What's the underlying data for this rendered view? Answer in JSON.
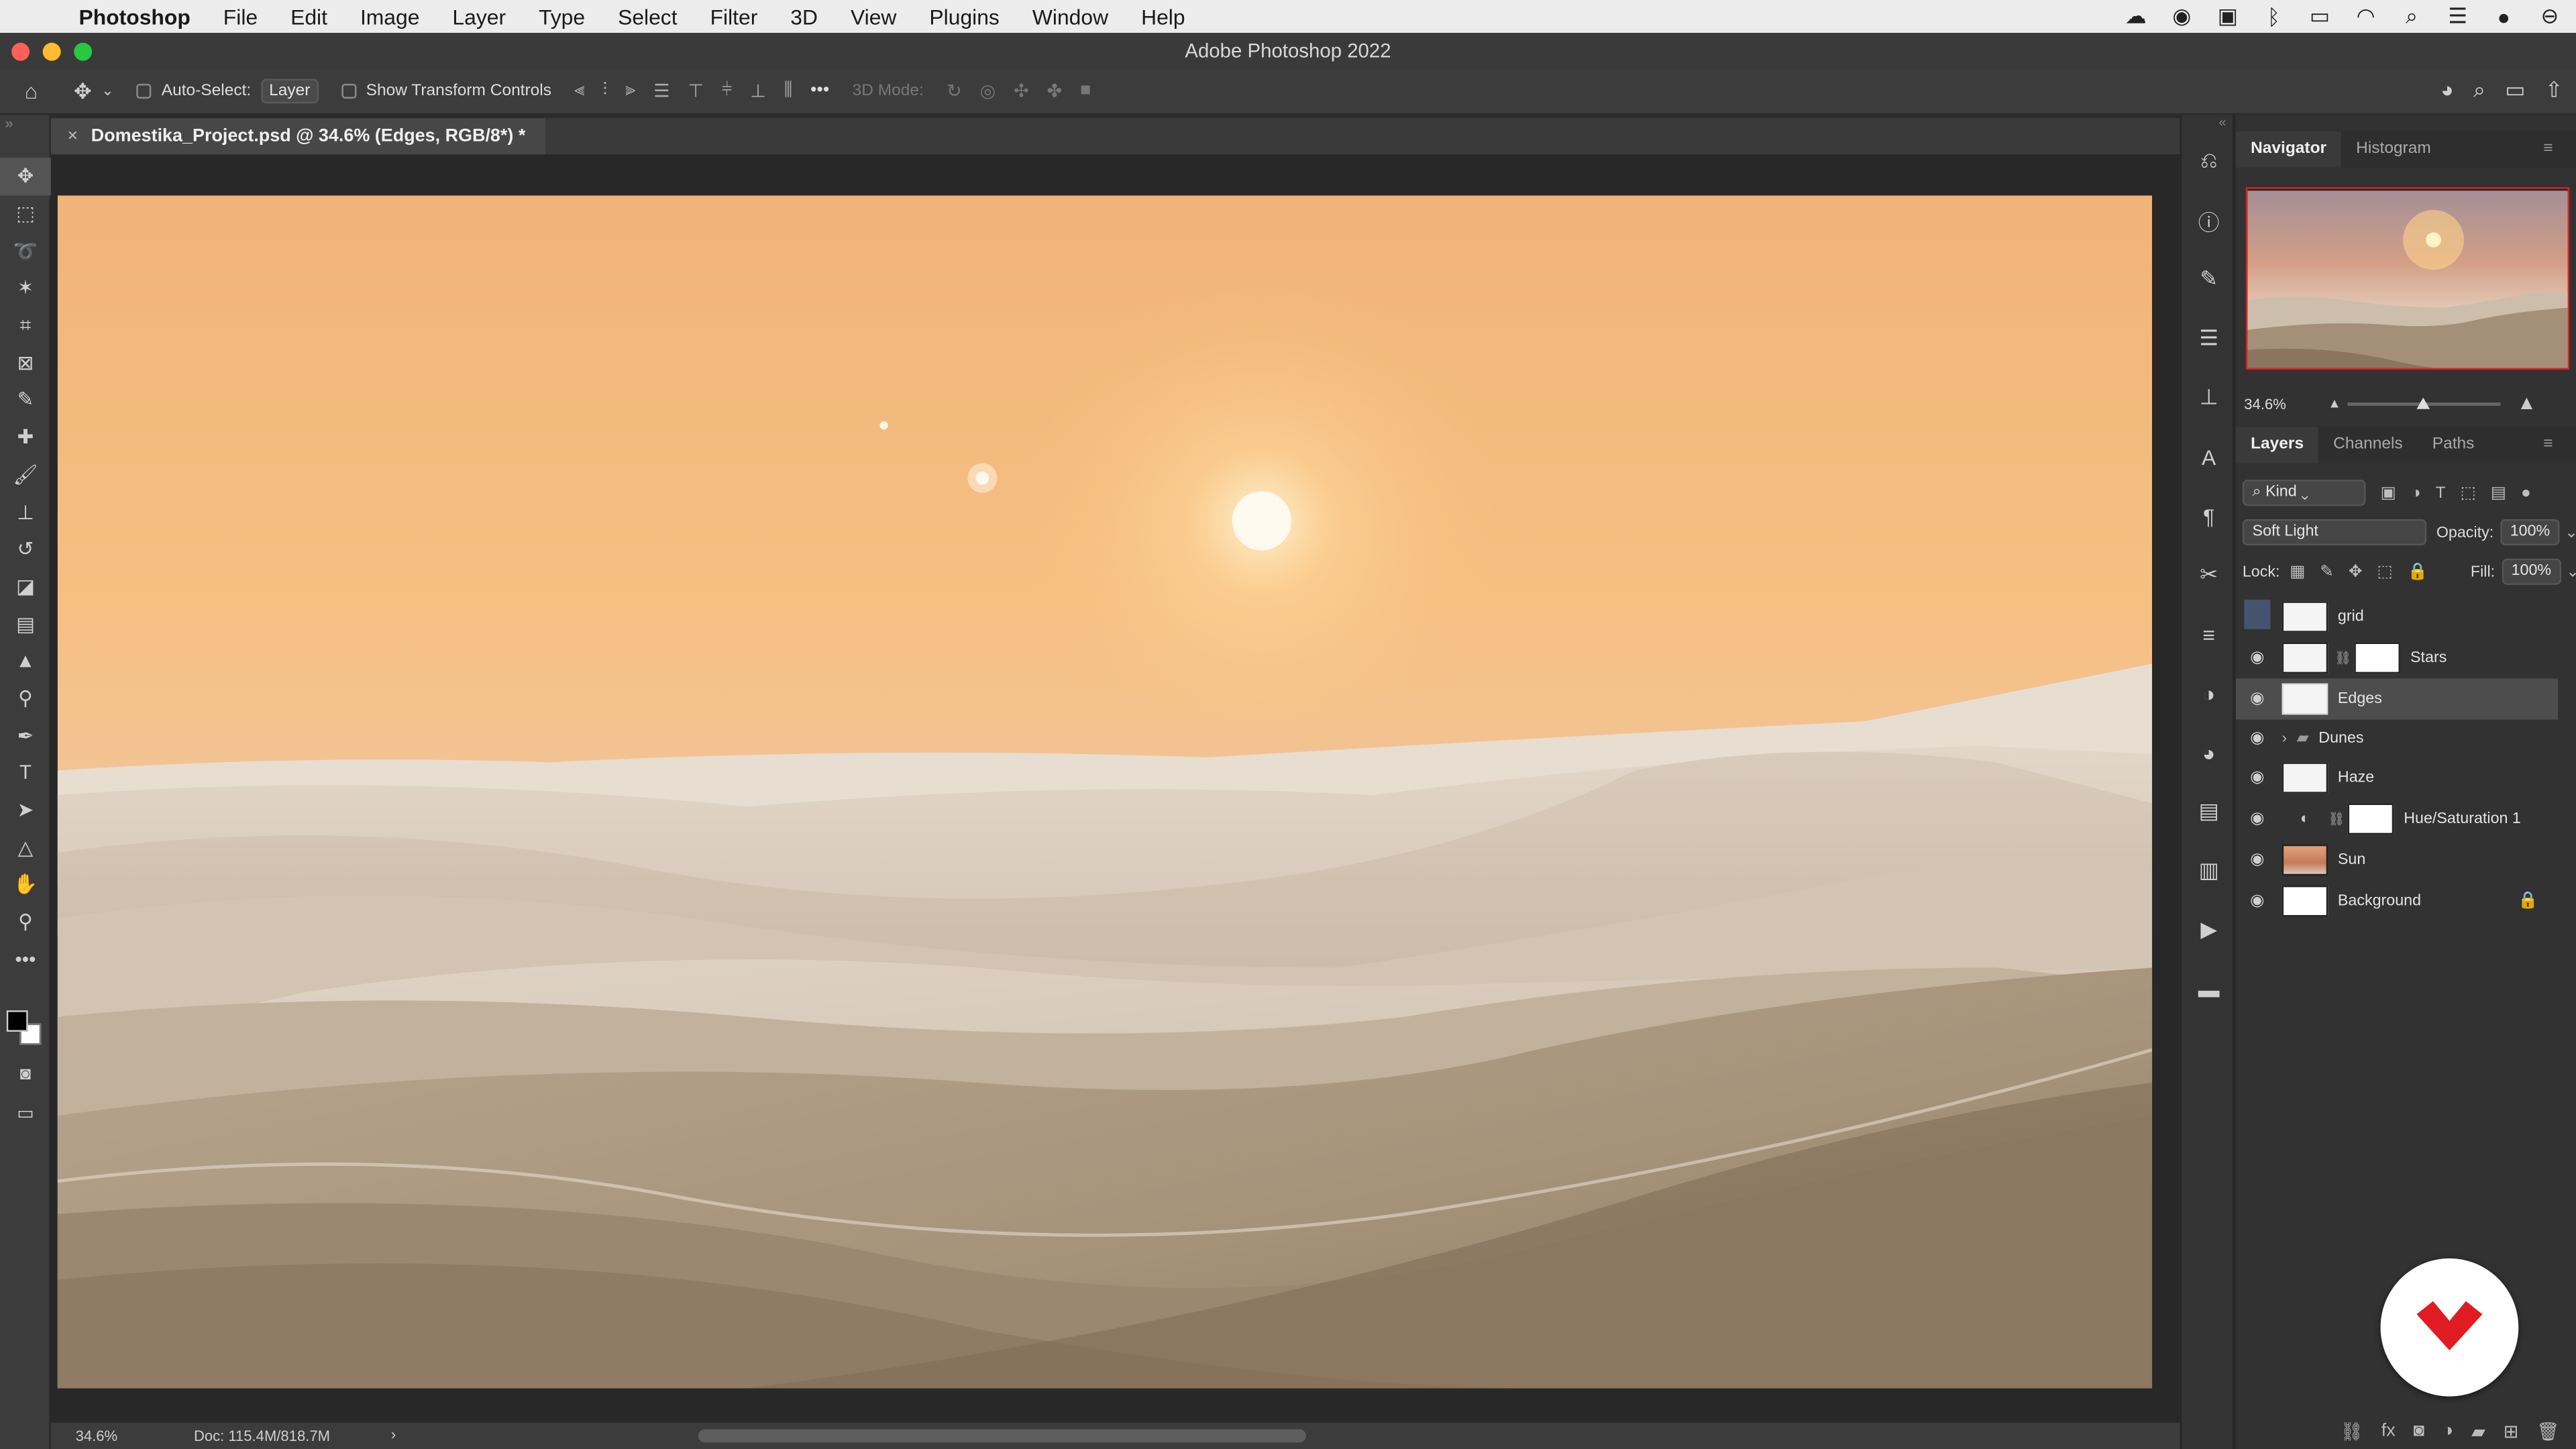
{
  "menubar": {
    "apple": "",
    "items": [
      "Photoshop",
      "File",
      "Edit",
      "Image",
      "Layer",
      "Type",
      "Select",
      "Filter",
      "3D",
      "View",
      "Plugins",
      "Window",
      "Help"
    ],
    "status_icons": [
      "creative-cloud-icon",
      "cc-libraries-icon",
      "screen-icon",
      "bluetooth-icon",
      "battery-icon",
      "wifi-icon",
      "search-icon",
      "control-center-icon",
      "siri-icon",
      "notification-icon"
    ]
  },
  "window": {
    "title": "Adobe Photoshop 2022"
  },
  "options_bar": {
    "auto_select_label": "Auto-Select:",
    "auto_select_value": "Layer",
    "transform_label": "Show Transform Controls",
    "mode_3d_label": "3D Mode:"
  },
  "document": {
    "tab_title": "Domestika_Project.psd @ 34.6% (Edges, RGB/8*) *",
    "close_glyph": "×"
  },
  "status_bar": {
    "zoom": "34.6%",
    "doc_size": "Doc: 115.4M/818.7M",
    "arrow": "›"
  },
  "navigator": {
    "tabs": [
      "Navigator",
      "Histogram"
    ],
    "zoom": "34.6%",
    "zoom_fraction": 0.55
  },
  "layers_panel": {
    "tabs": [
      "Layers",
      "Channels",
      "Paths"
    ],
    "filter_kind": "Kind",
    "blend_mode": "Soft Light",
    "opacity_label": "Opacity:",
    "opacity_value": "100%",
    "lock_label": "Lock:",
    "fill_label": "Fill:",
    "fill_value": "100%",
    "layers": [
      {
        "name": "grid",
        "visible": false
      },
      {
        "name": "Stars",
        "visible": true
      },
      {
        "name": "Edges",
        "visible": true,
        "selected": true
      },
      {
        "name": "Dunes",
        "visible": true,
        "group": true
      },
      {
        "name": "Haze",
        "visible": true
      },
      {
        "name": "Hue/Saturation 1",
        "visible": true,
        "adjustment": true
      },
      {
        "name": "Sun",
        "visible": true
      },
      {
        "name": "Background",
        "visible": true,
        "locked": true
      }
    ]
  },
  "colors": {
    "sky_top": "#f2b57a",
    "sky_mid": "#fac583",
    "horizon": "#ece2d6",
    "dune_light": "#dcd0c2",
    "dune_dark": "#8e7b66",
    "ui_panel": "#323232",
    "selection": "#e02020",
    "brand": "#e01b22"
  }
}
